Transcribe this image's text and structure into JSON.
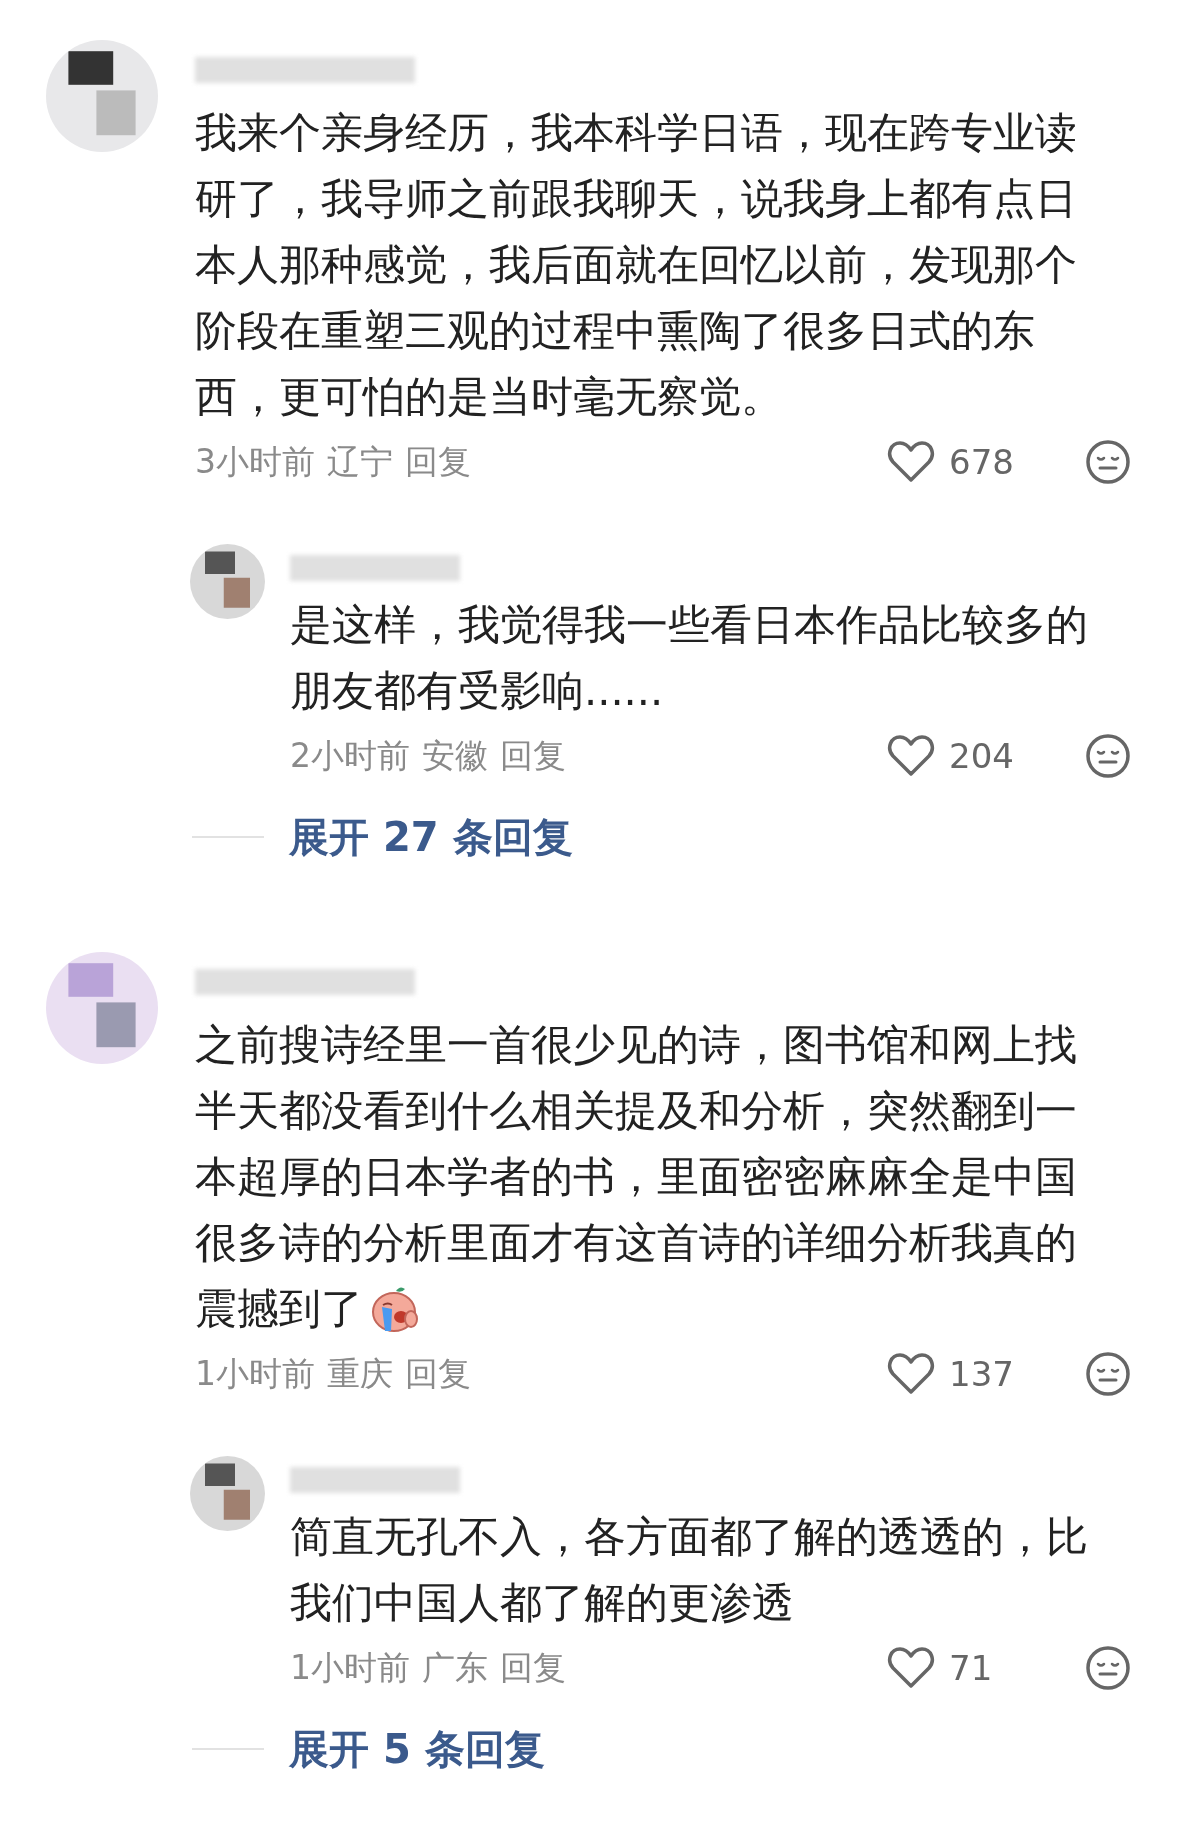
{
  "comments": [
    {
      "text": "我来个亲身经历，我本科学日语，现在跨专业读研了，我导师之前跟我聊天，说我身上都有点日本人那种感觉，我后面就在回忆以前，发现那个阶段在重塑三观的过程中熏陶了很多日式的东西，更可怕的是当时毫无察觉。",
      "time": "3小时前",
      "location": "辽宁",
      "reply_label": "回复",
      "likes": "678",
      "emoji_suffix": false,
      "replies": [
        {
          "text": "是这样，我觉得我一些看日本作品比较多的朋友都有受影响......",
          "time": "2小时前",
          "location": "安徽",
          "reply_label": "回复",
          "likes": "204"
        }
      ],
      "expand": "展开 27 条回复"
    },
    {
      "text": "之前搜诗经里一首很少见的诗，图书馆和网上找半天都没看到什么相关提及和分析，突然翻到一本超厚的日本学者的书，里面密密麻麻全是中国很多诗的分析里面才有这首诗的详细分析我真的震撼到了",
      "time": "1小时前",
      "location": "重庆",
      "reply_label": "回复",
      "likes": "137",
      "emoji_suffix": true,
      "replies": [
        {
          "text": "简直无孔不入，各方面都了解的透透的，比我们中国人都了解的更渗透",
          "time": "1小时前",
          "location": "广东",
          "reply_label": "回复",
          "likes": "71"
        }
      ],
      "expand": "展开 5 条回复"
    }
  ]
}
